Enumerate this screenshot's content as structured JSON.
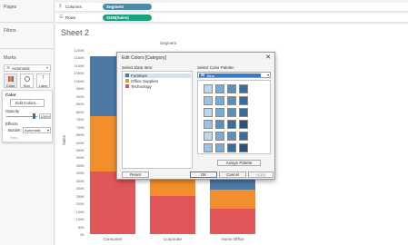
{
  "panels": {
    "pages": "Pages",
    "filters": "Filters",
    "marks": "Marks",
    "marks_type": "Automatic",
    "mark_buttons": [
      "Color",
      "Size",
      "Label"
    ],
    "color_section": "Color",
    "edit_colors_btn": "Edit Colors...",
    "opacity_label": "Opacity",
    "opacity_value": "100%",
    "effects_label": "Effects",
    "border_label": "Border:",
    "border_value": "Automatic",
    "halo_label": "Halo:"
  },
  "shelves": {
    "columns_label": "Columns",
    "columns_pill": "Segment",
    "rows_label": "Rows",
    "rows_pill": "SUM(Sales)"
  },
  "sheet": {
    "title": "Sheet 2",
    "header": "Segment",
    "y_axis_label": "Sales",
    "y_ticks": [
      "1200K",
      "1150K",
      "1100K",
      "1050K",
      "1000K",
      "950K",
      "900K",
      "850K",
      "800K",
      "750K",
      "700K",
      "650K",
      "600K",
      "550K",
      "500K",
      "450K",
      "400K",
      "350K",
      "300K",
      "250K",
      "200K",
      "150K",
      "100K",
      "50K",
      "0K"
    ]
  },
  "chart_data": {
    "type": "bar",
    "stacked": true,
    "categories": [
      "Consumer",
      "Corporate",
      "Home Office"
    ],
    "series": [
      {
        "name": "Technology",
        "values": [
          406000,
          246000,
          167000
        ]
      },
      {
        "name": "Office Supplies",
        "values": [
          363000,
          231000,
          124000
        ]
      },
      {
        "name": "Furniture",
        "values": [
          392000,
          230000,
          128000
        ]
      }
    ],
    "ylabel": "Sales",
    "ylim": [
      0,
      1200000
    ],
    "colors": {
      "Technology": "#e15759",
      "Office Supplies": "#f28e2b",
      "Furniture": "#4e79a7"
    }
  },
  "dialog": {
    "title": "Edit Colors [Category]",
    "select_item_label": "Select Data Item:",
    "items": [
      "Furniture",
      "Office Supplies",
      "Technology"
    ],
    "item_colors": [
      "#4e79a7",
      "#f28e2b",
      "#e15759"
    ],
    "palette_label": "Select Color Palette:",
    "palette_value": "Blue",
    "assign_btn": "Assign Palette",
    "reset_btn": "Reset",
    "ok_btn": "OK",
    "cancel_btn": "Cancel",
    "apply_btn": "Apply",
    "palette_colors": [
      "#bcd6ec",
      "#9ec2e2",
      "#7aaad4",
      "#5d8fbd",
      "#3b6c9c",
      "#2c5278"
    ]
  }
}
